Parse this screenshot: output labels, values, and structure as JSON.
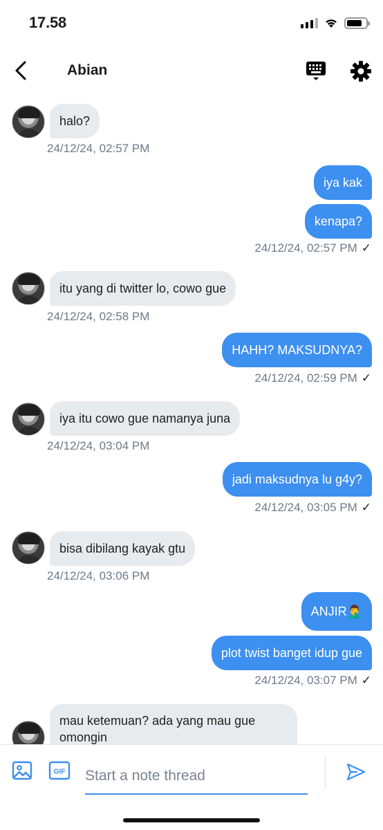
{
  "status_bar": {
    "time": "17.58"
  },
  "header": {
    "title": "Abian"
  },
  "messages": [
    {
      "dir": "in",
      "text": "halo?",
      "timestamp": "24/12/24, 02:57 PM"
    },
    {
      "dir": "out",
      "text": "iya kak"
    },
    {
      "dir": "out",
      "text": "kenapa?",
      "timestamp": "24/12/24, 02:57 PM",
      "status": "✓"
    },
    {
      "dir": "in",
      "text": "itu yang di twitter lo, cowo gue",
      "timestamp": "24/12/24, 02:58 PM"
    },
    {
      "dir": "out",
      "text": "HAHH? MAKSUDNYA?",
      "timestamp": "24/12/24, 02:59 PM",
      "status": "✓"
    },
    {
      "dir": "in",
      "text": "iya itu cowo gue namanya juna",
      "timestamp": "24/12/24, 03:04 PM"
    },
    {
      "dir": "out",
      "text": "jadi maksudnya lu g4y?",
      "timestamp": "24/12/24, 03:05 PM",
      "status": "✓"
    },
    {
      "dir": "in",
      "text": "bisa dibilang kayak gtu",
      "timestamp": "24/12/24, 03:06 PM"
    },
    {
      "dir": "out",
      "text": "ANJIR🤦‍♂️"
    },
    {
      "dir": "out",
      "text": "plot twist banget idup gue",
      "timestamp": "24/12/24, 03:07 PM",
      "status": "✓"
    },
    {
      "dir": "in",
      "text": "mau ketemuan? ada yang mau gue omongin"
    }
  ],
  "composer": {
    "placeholder": "Start a note thread",
    "gif_label": "GIF"
  },
  "icons": {
    "back": "chevron-left-icon",
    "keyboard": "keyboard-icon",
    "settings": "gear-icon",
    "image": "image-icon",
    "gif": "gif-icon",
    "send": "send-icon"
  },
  "colors": {
    "outgoing_bubble": "#3d8ff0",
    "incoming_bubble": "#e8ebee",
    "timestamp": "#6c7a88",
    "accent": "#3d8ff0"
  }
}
